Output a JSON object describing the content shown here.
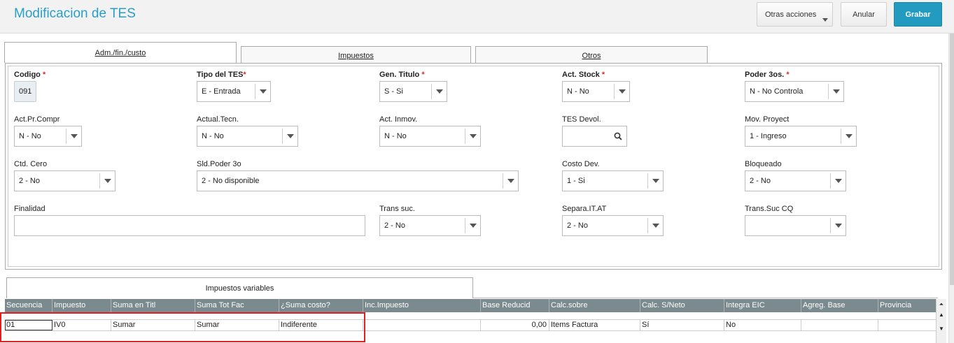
{
  "header": {
    "title": "Modificacion de TES",
    "otras_acciones": "Otras acciones",
    "anular": "Anular",
    "grabar": "Grabar"
  },
  "tabs": [
    {
      "label": "Adm./fin./custo",
      "active": true
    },
    {
      "label": "Impuestos",
      "active": false
    },
    {
      "label": "Otros",
      "active": false
    }
  ],
  "form": {
    "codigo": {
      "label": "Codigo",
      "required": "*",
      "value": "091"
    },
    "tipo_tes": {
      "label": "Tipo del TES",
      "required": "*",
      "value": "E - Entrada"
    },
    "gen_titulo": {
      "label": "Gen. Titulo",
      "required": "*",
      "value": "S - Si"
    },
    "act_stock": {
      "label": "Act. Stock",
      "required": "*",
      "value": "N - No"
    },
    "poder_3os": {
      "label": "Poder 3os.",
      "required": "*",
      "value": "N - No Controla"
    },
    "act_pr_compr": {
      "label": "Act.Pr.Compr",
      "value": "N - No"
    },
    "actual_tecn": {
      "label": "Actual.Tecn.",
      "value": "N - No"
    },
    "act_inmov": {
      "label": "Act. Inmov.",
      "value": "N - No"
    },
    "tes_devol": {
      "label": "TES Devol.",
      "value": ""
    },
    "mov_proyect": {
      "label": "Mov. Proyect",
      "value": "1 - Ingreso"
    },
    "ctd_cero": {
      "label": "Ctd. Cero",
      "value": "2 - No"
    },
    "sld_poder_3o": {
      "label": "Sld.Poder 3o",
      "value": "2 - No disponible"
    },
    "costo_dev": {
      "label": "Costo Dev.",
      "value": "1 - Si"
    },
    "bloqueado": {
      "label": "Bloqueado",
      "value": "2 - No"
    },
    "finalidad": {
      "label": "Finalidad",
      "value": ""
    },
    "trans_suc": {
      "label": "Trans suc.",
      "value": "2 - No"
    },
    "separa_it_at": {
      "label": "Separa.IT.AT",
      "value": "2 - No"
    },
    "trans_suc_cq": {
      "label": "Trans.Suc CQ",
      "value": ""
    }
  },
  "subtab": {
    "label": "Impuestos variables"
  },
  "grid": {
    "headers": [
      "Secuencia",
      "Impuesto",
      "Suma en Titl",
      "Suma Tot Fac",
      "¿Suma costo?",
      "Inc.Impuesto",
      "Base Reducid",
      "Calc.sobre",
      "Calc. S/Neto",
      "Integra EIC",
      "Agreg. Base",
      "Provincia"
    ],
    "rows": [
      [
        "01",
        "IV0",
        "Sumar",
        "Sumar",
        "Indiferente",
        "",
        "0,00",
        "Items Factura",
        "Sí",
        "No",
        "",
        ""
      ]
    ]
  }
}
